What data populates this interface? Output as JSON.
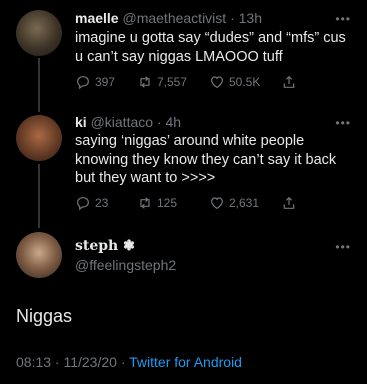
{
  "tweets": [
    {
      "name": "maelle",
      "handle": "@maetheactivist",
      "time": "· 13h",
      "text": "imagine u gotta say “dudes” and “mfs” cus u can’t say niggas LMAOOO tuff",
      "replies": "397",
      "retweets": "7,557",
      "likes": "50.5K"
    },
    {
      "name": "ki",
      "handle": "@kiattaco",
      "time": "· 4h",
      "text": "saying ‘niggas’ around white people knowing they know they can’t say it back but they want to >>>>",
      "replies": "23",
      "retweets": "125",
      "likes": "2,631"
    }
  ],
  "main": {
    "name": "steph ❃",
    "handle": "@ffeelingsteph2",
    "text": "Niggas",
    "time": "08:13 · 11/23/20 · ",
    "app": "Twitter for Android"
  },
  "more_label": "•••"
}
